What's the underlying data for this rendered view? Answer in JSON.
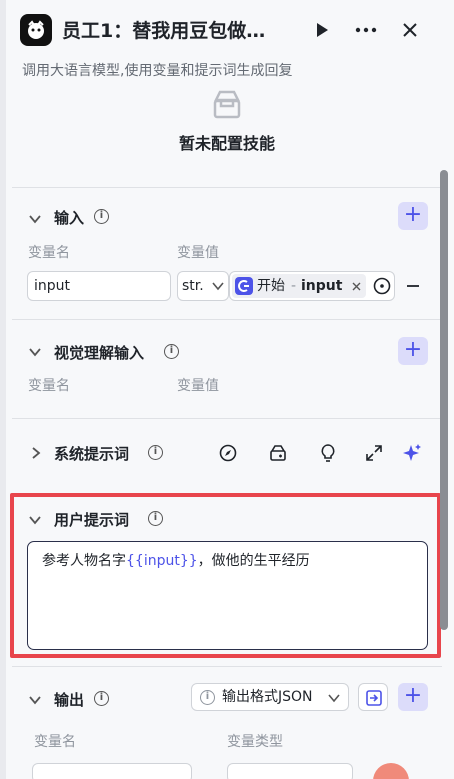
{
  "header": {
    "title": "员工1：替我用豆包做…",
    "subtitle": "调用大语言模型,使用变量和提示词生成回复"
  },
  "skills": {
    "empty_text": "暂未配置技能"
  },
  "input_section": {
    "title": "输入",
    "col_name": "变量名",
    "col_value": "变量值",
    "var_name": "input",
    "type_select": "str.",
    "ref_source": "开始",
    "ref_sep": "-",
    "ref_var": "input",
    "remove_label": "—"
  },
  "vision_section": {
    "title": "视觉理解输入",
    "col_name": "变量名",
    "col_value": "变量值"
  },
  "system_prompt": {
    "title": "系统提示词"
  },
  "user_prompt": {
    "title": "用户提示词",
    "text_before": "参考人物名字",
    "var_token": "{{input}}",
    "text_after": "，做他的生平经历"
  },
  "output_section": {
    "title": "输出",
    "format_label": "输出格式JSON",
    "col_name": "变量名",
    "col_type": "变量类型"
  },
  "colors": {
    "accent": "#4d53e8",
    "highlight": "#e8454c"
  }
}
